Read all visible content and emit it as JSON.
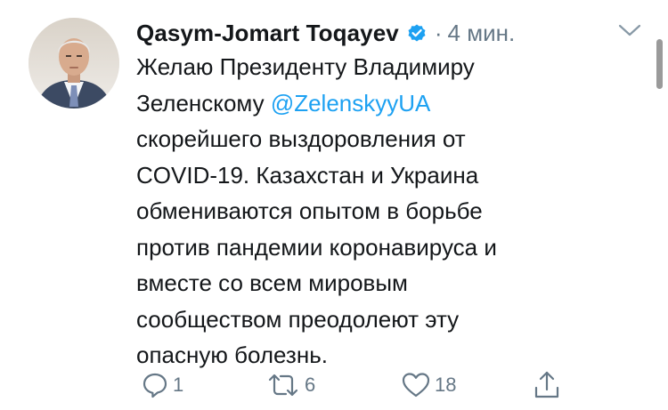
{
  "tweet": {
    "author_name": "Qasym-Jomart Toqayev",
    "separator": "·",
    "timestamp": "4 мин.",
    "verified": true,
    "text_lines": [
      {
        "before": "Желаю Президенту Владимиру",
        "mention": "",
        "after": ""
      },
      {
        "before": "Зеленскому ",
        "mention": "@ZelenskyyUA",
        "after": ""
      },
      {
        "before": "скорейшего выздоровления от",
        "mention": "",
        "after": ""
      },
      {
        "before": "COVID-19. Казахстан и Украина",
        "mention": "",
        "after": ""
      },
      {
        "before": "обмениваются опытом в борьбе",
        "mention": "",
        "after": ""
      },
      {
        "before": "против пандемии коронавируса и",
        "mention": "",
        "after": ""
      },
      {
        "before": "вместе со всем мировым",
        "mention": "",
        "after": ""
      },
      {
        "before": "сообществом преодолеют эту",
        "mention": "",
        "after": ""
      },
      {
        "before": "опасную болезнь.",
        "mention": "",
        "after": ""
      }
    ]
  },
  "actions": {
    "reply": {
      "icon": "reply-icon",
      "count": "1"
    },
    "retweet": {
      "icon": "retweet-icon",
      "count": "6"
    },
    "like": {
      "icon": "heart-icon",
      "count": "18"
    },
    "share": {
      "icon": "share-icon",
      "count": ""
    }
  },
  "colors": {
    "text": "#14171a",
    "secondary": "#657786",
    "link": "#1da1f2",
    "verified_badge": "#1da1f2"
  }
}
